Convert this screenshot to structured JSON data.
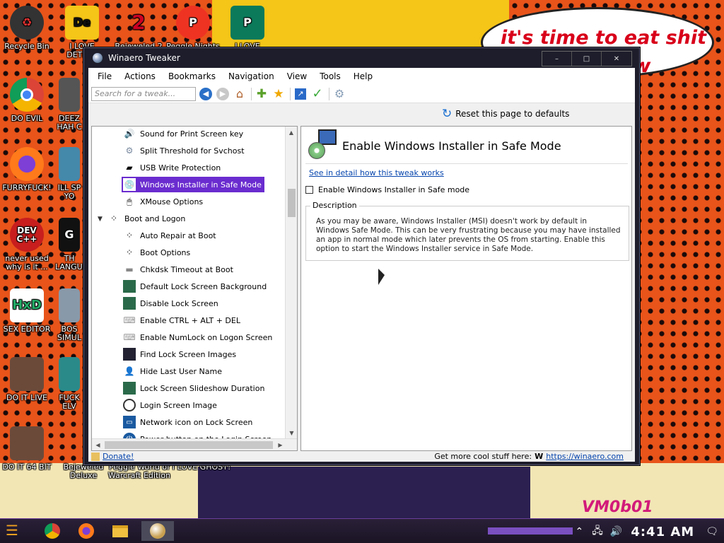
{
  "desktop": {
    "speech_text_line1": "it's time to eat shit",
    "speech_text_line2": "hew",
    "corner_text": "VM0b01",
    "icons": [
      {
        "label": "Recycle Bin"
      },
      {
        "label": "I LOVE DETECT"
      },
      {
        "label": "Bejeweled 2"
      },
      {
        "label": "Peggle Nights"
      },
      {
        "label": "I LOVE"
      },
      {
        "label": "DO EVIL"
      },
      {
        "label": "DEEZ HAH C"
      },
      {
        "label": "FURRYFUCK!"
      },
      {
        "label": "ILL SP YO"
      },
      {
        "label": "never used why is it ..."
      },
      {
        "label": "TH LANGUA"
      },
      {
        "label": "SEX EDITOR"
      },
      {
        "label": "BOS SIMUL"
      },
      {
        "label": "DO IT LIVE"
      },
      {
        "label": "FUCK ELV"
      },
      {
        "label": "DO IT 64 BIT"
      },
      {
        "label": "Bejeweled Deluxe"
      },
      {
        "label": "Peggle World of Warcraft Edition"
      },
      {
        "label": "I LOVE GHOST!"
      }
    ]
  },
  "window": {
    "title": "Winaero Tweaker",
    "controls": {
      "minimize": "–",
      "maximize": "□",
      "close": "✕"
    }
  },
  "menu": [
    "File",
    "Actions",
    "Bookmarks",
    "Navigation",
    "View",
    "Tools",
    "Help"
  ],
  "toolbar": {
    "search_placeholder": "Search for a tweak...",
    "reset_label": "Reset this page to defaults"
  },
  "tree": {
    "items": [
      {
        "label": "Sound for Print Screen key",
        "icon": "speaker-icon"
      },
      {
        "label": "Split Threshold for Svchost",
        "icon": "gear-icon"
      },
      {
        "label": "USB Write Protection",
        "icon": "usb-icon"
      },
      {
        "label": "Windows Installer in Safe Mode",
        "icon": "installer-icon",
        "selected": true
      },
      {
        "label": "XMouse Options",
        "icon": "mouse-icon"
      },
      {
        "label": "Boot and Logon",
        "icon": "spinner-icon",
        "category": true
      },
      {
        "label": "Auto Repair at Boot",
        "icon": "spinner-icon"
      },
      {
        "label": "Boot Options",
        "icon": "spinner-icon"
      },
      {
        "label": "Chkdsk Timeout at Boot",
        "icon": "disk-icon"
      },
      {
        "label": "Default Lock Screen Background",
        "icon": "picture-icon"
      },
      {
        "label": "Disable Lock Screen",
        "icon": "picture-icon"
      },
      {
        "label": "Enable CTRL + ALT + DEL",
        "icon": "keyboard-icon"
      },
      {
        "label": "Enable NumLock on Logon Screen",
        "icon": "keyboard-icon"
      },
      {
        "label": "Find Lock Screen Images",
        "icon": "image-icon"
      },
      {
        "label": "Hide Last User Name",
        "icon": "user-icon"
      },
      {
        "label": "Lock Screen Slideshow Duration",
        "icon": "picture-icon"
      },
      {
        "label": "Login Screen Image",
        "icon": "user-circle-icon"
      },
      {
        "label": "Network icon on Lock Screen",
        "icon": "network-icon"
      },
      {
        "label": "Power button on the Login Screen",
        "icon": "power-icon"
      }
    ]
  },
  "detail": {
    "title": "Enable Windows Installer in Safe Mode",
    "link": "See in detail how this tweak works",
    "checkbox_label": "Enable Windows Installer in Safe mode",
    "checkbox_checked": false,
    "description_legend": "Description",
    "description_text": "As you may be aware, Windows Installer (MSI) doesn't work by default in Windows Safe Mode. This can be very frustrating because you may have installed an app in normal mode which later prevents the OS from starting. Enable this option to start the Windows Installer service in Safe Mode."
  },
  "status": {
    "donate": "Donate!",
    "more_text": "Get more cool stuff here:",
    "w_letter": "W",
    "site": "https://winaero.com"
  },
  "taskbar": {
    "time": "4:41 AM"
  },
  "colors": {
    "selection": "#6a2ccf",
    "link": "#0645ad",
    "taskbar_accent": "#7a4fc0"
  }
}
